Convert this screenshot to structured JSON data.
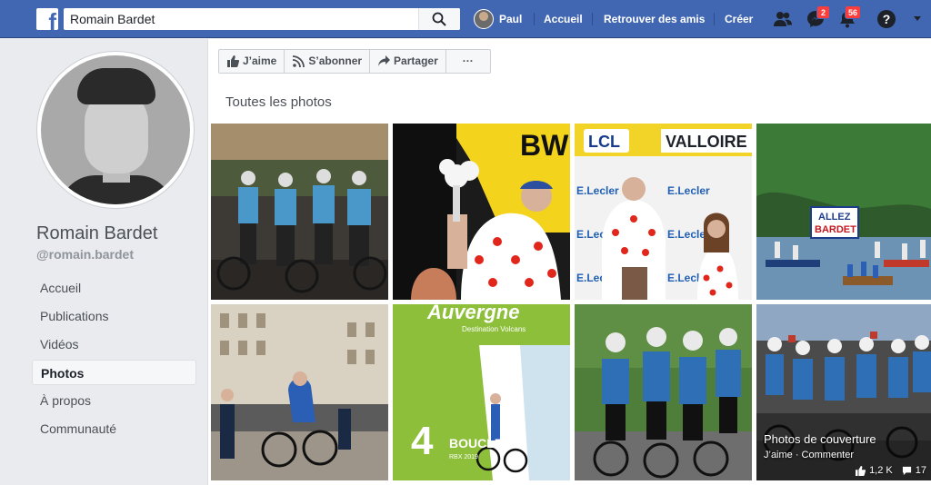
{
  "topbar": {
    "logo": "f",
    "search_value": "Romain Bardet",
    "user_name": "Paul",
    "home": "Accueil",
    "find_friends": "Retrouver des amis",
    "create": "Créer",
    "messages_count": "2",
    "notifications_count": "56",
    "help": "?"
  },
  "sidebar": {
    "page_name": "Romain Bardet",
    "page_handle": "@romain.bardet",
    "items": [
      {
        "label": "Accueil"
      },
      {
        "label": "Publications"
      },
      {
        "label": "Vidéos"
      },
      {
        "label": "Photos"
      },
      {
        "label": "À propos"
      },
      {
        "label": "Communauté"
      }
    ]
  },
  "actions": {
    "like": "J’aime",
    "follow": "S’abonner",
    "share": "Partager",
    "more": "···"
  },
  "photos": {
    "title": "Toutes les photos",
    "tile1_text": "",
    "tile2_text": "BW",
    "tile3_top_left": "LCL",
    "tile3_top_right": "VALLOIRE",
    "tile3_brand": "E.Lecler",
    "tile4_banner_line1": "ALLEZ",
    "tile4_banner_line2": "BARDET",
    "tile6_top": "Auvergne",
    "tile6_sub": "Destination Volcans",
    "tile6_number": "4",
    "tile6_word": "BOUCLES",
    "tile6_small": "RBX 2019",
    "cover": {
      "title": "Photos de couverture",
      "actions": "J’aime · Commenter",
      "likes": "1,2 K",
      "comments": "17"
    }
  },
  "colors": {
    "brand": "#4267b2",
    "badge": "#fa3e3e"
  }
}
